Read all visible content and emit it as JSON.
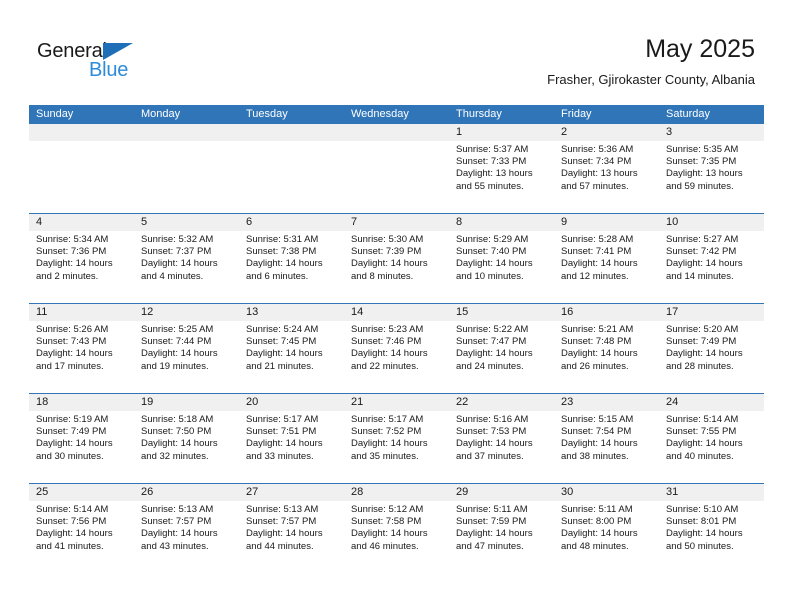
{
  "brand": {
    "name_part1": "General",
    "name_part2": "Blue",
    "triangle_color": "#1F6FB8",
    "blue_color": "#2E8BD8"
  },
  "header": {
    "title": "May 2025",
    "subtitle": "Frasher, Gjirokaster County, Albania"
  },
  "theme": {
    "header_blue": "#3075B8",
    "date_band_gray": "#F0F0F0",
    "cell_white": "#FFFFFF"
  },
  "weekdays": [
    "Sunday",
    "Monday",
    "Tuesday",
    "Wednesday",
    "Thursday",
    "Friday",
    "Saturday"
  ],
  "weeks": [
    [
      {
        "day": "",
        "empty": true
      },
      {
        "day": "",
        "empty": true
      },
      {
        "day": "",
        "empty": true
      },
      {
        "day": "",
        "empty": true
      },
      {
        "day": "1",
        "sunrise": "Sunrise: 5:37 AM",
        "sunset": "Sunset: 7:33 PM",
        "daylight": "Daylight: 13 hours and 55 minutes."
      },
      {
        "day": "2",
        "sunrise": "Sunrise: 5:36 AM",
        "sunset": "Sunset: 7:34 PM",
        "daylight": "Daylight: 13 hours and 57 minutes."
      },
      {
        "day": "3",
        "sunrise": "Sunrise: 5:35 AM",
        "sunset": "Sunset: 7:35 PM",
        "daylight": "Daylight: 13 hours and 59 minutes."
      }
    ],
    [
      {
        "day": "4",
        "sunrise": "Sunrise: 5:34 AM",
        "sunset": "Sunset: 7:36 PM",
        "daylight": "Daylight: 14 hours and 2 minutes."
      },
      {
        "day": "5",
        "sunrise": "Sunrise: 5:32 AM",
        "sunset": "Sunset: 7:37 PM",
        "daylight": "Daylight: 14 hours and 4 minutes."
      },
      {
        "day": "6",
        "sunrise": "Sunrise: 5:31 AM",
        "sunset": "Sunset: 7:38 PM",
        "daylight": "Daylight: 14 hours and 6 minutes."
      },
      {
        "day": "7",
        "sunrise": "Sunrise: 5:30 AM",
        "sunset": "Sunset: 7:39 PM",
        "daylight": "Daylight: 14 hours and 8 minutes."
      },
      {
        "day": "8",
        "sunrise": "Sunrise: 5:29 AM",
        "sunset": "Sunset: 7:40 PM",
        "daylight": "Daylight: 14 hours and 10 minutes."
      },
      {
        "day": "9",
        "sunrise": "Sunrise: 5:28 AM",
        "sunset": "Sunset: 7:41 PM",
        "daylight": "Daylight: 14 hours and 12 minutes."
      },
      {
        "day": "10",
        "sunrise": "Sunrise: 5:27 AM",
        "sunset": "Sunset: 7:42 PM",
        "daylight": "Daylight: 14 hours and 14 minutes."
      }
    ],
    [
      {
        "day": "11",
        "sunrise": "Sunrise: 5:26 AM",
        "sunset": "Sunset: 7:43 PM",
        "daylight": "Daylight: 14 hours and 17 minutes."
      },
      {
        "day": "12",
        "sunrise": "Sunrise: 5:25 AM",
        "sunset": "Sunset: 7:44 PM",
        "daylight": "Daylight: 14 hours and 19 minutes."
      },
      {
        "day": "13",
        "sunrise": "Sunrise: 5:24 AM",
        "sunset": "Sunset: 7:45 PM",
        "daylight": "Daylight: 14 hours and 21 minutes."
      },
      {
        "day": "14",
        "sunrise": "Sunrise: 5:23 AM",
        "sunset": "Sunset: 7:46 PM",
        "daylight": "Daylight: 14 hours and 22 minutes."
      },
      {
        "day": "15",
        "sunrise": "Sunrise: 5:22 AM",
        "sunset": "Sunset: 7:47 PM",
        "daylight": "Daylight: 14 hours and 24 minutes."
      },
      {
        "day": "16",
        "sunrise": "Sunrise: 5:21 AM",
        "sunset": "Sunset: 7:48 PM",
        "daylight": "Daylight: 14 hours and 26 minutes."
      },
      {
        "day": "17",
        "sunrise": "Sunrise: 5:20 AM",
        "sunset": "Sunset: 7:49 PM",
        "daylight": "Daylight: 14 hours and 28 minutes."
      }
    ],
    [
      {
        "day": "18",
        "sunrise": "Sunrise: 5:19 AM",
        "sunset": "Sunset: 7:49 PM",
        "daylight": "Daylight: 14 hours and 30 minutes."
      },
      {
        "day": "19",
        "sunrise": "Sunrise: 5:18 AM",
        "sunset": "Sunset: 7:50 PM",
        "daylight": "Daylight: 14 hours and 32 minutes."
      },
      {
        "day": "20",
        "sunrise": "Sunrise: 5:17 AM",
        "sunset": "Sunset: 7:51 PM",
        "daylight": "Daylight: 14 hours and 33 minutes."
      },
      {
        "day": "21",
        "sunrise": "Sunrise: 5:17 AM",
        "sunset": "Sunset: 7:52 PM",
        "daylight": "Daylight: 14 hours and 35 minutes."
      },
      {
        "day": "22",
        "sunrise": "Sunrise: 5:16 AM",
        "sunset": "Sunset: 7:53 PM",
        "daylight": "Daylight: 14 hours and 37 minutes."
      },
      {
        "day": "23",
        "sunrise": "Sunrise: 5:15 AM",
        "sunset": "Sunset: 7:54 PM",
        "daylight": "Daylight: 14 hours and 38 minutes."
      },
      {
        "day": "24",
        "sunrise": "Sunrise: 5:14 AM",
        "sunset": "Sunset: 7:55 PM",
        "daylight": "Daylight: 14 hours and 40 minutes."
      }
    ],
    [
      {
        "day": "25",
        "sunrise": "Sunrise: 5:14 AM",
        "sunset": "Sunset: 7:56 PM",
        "daylight": "Daylight: 14 hours and 41 minutes."
      },
      {
        "day": "26",
        "sunrise": "Sunrise: 5:13 AM",
        "sunset": "Sunset: 7:57 PM",
        "daylight": "Daylight: 14 hours and 43 minutes."
      },
      {
        "day": "27",
        "sunrise": "Sunrise: 5:13 AM",
        "sunset": "Sunset: 7:57 PM",
        "daylight": "Daylight: 14 hours and 44 minutes."
      },
      {
        "day": "28",
        "sunrise": "Sunrise: 5:12 AM",
        "sunset": "Sunset: 7:58 PM",
        "daylight": "Daylight: 14 hours and 46 minutes."
      },
      {
        "day": "29",
        "sunrise": "Sunrise: 5:11 AM",
        "sunset": "Sunset: 7:59 PM",
        "daylight": "Daylight: 14 hours and 47 minutes."
      },
      {
        "day": "30",
        "sunrise": "Sunrise: 5:11 AM",
        "sunset": "Sunset: 8:00 PM",
        "daylight": "Daylight: 14 hours and 48 minutes."
      },
      {
        "day": "31",
        "sunrise": "Sunrise: 5:10 AM",
        "sunset": "Sunset: 8:01 PM",
        "daylight": "Daylight: 14 hours and 50 minutes."
      }
    ]
  ]
}
